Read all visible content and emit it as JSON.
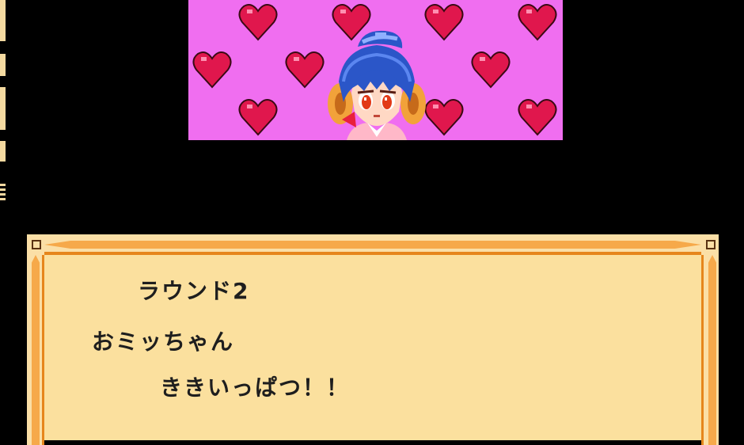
{
  "scene": {
    "portrait": {
      "background_color": "#f06ef0",
      "heart_color": "#e0174d",
      "heart_count": 12,
      "character": "omi-chan-portrait"
    },
    "dialog": {
      "lines": [
        "ラウンド2",
        "おミッちゃん",
        "ききいっぱつ！！"
      ],
      "frame_color": "#e6861c",
      "fill_color": "#fbe09e"
    }
  }
}
